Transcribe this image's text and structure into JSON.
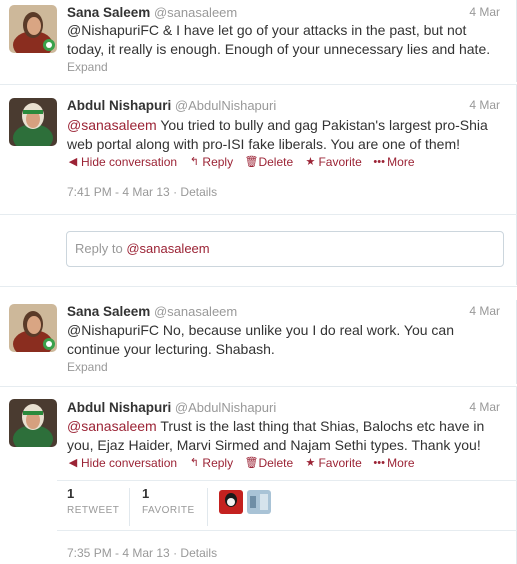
{
  "tweets": [
    {
      "fullname": "Sana Saleem",
      "username": "@sanasaleem",
      "date": "4 Mar",
      "text": "@NishapuriFC & I have let go of your attacks in the past, but not today, it really is enough. Enough of your unnecessary lies and hate.",
      "expand": "Expand"
    },
    {
      "fullname": "Abdul Nishapuri",
      "username": "@AbdulNishapuri",
      "date": "4 Mar",
      "mention": "@sanasaleem",
      "text": " You tried to bully and gag Pakistan's largest pro-Shia web portal along with pro-ISI fake liberals. You are one of them!",
      "actions": {
        "hide": "Hide conversation",
        "reply": "Reply",
        "delete": "Delete",
        "favorite": "Favorite",
        "more": "More"
      },
      "timestamp": "7:41 PM - 4 Mar 13",
      "details": "Details"
    },
    {
      "fullname": "Sana Saleem",
      "username": "@sanasaleem",
      "date": "4 Mar",
      "text": "@NishapuriFC No, because unlike you I do real work. You can continue your lecturing. Shabash.",
      "expand": "Expand"
    },
    {
      "fullname": "Abdul Nishapuri",
      "username": "@AbdulNishapuri",
      "date": "4 Mar",
      "mention": "@sanasaleem",
      "text": " Trust is the last thing that Shias, Balochs etc have in you, Ejaz Haider, Marvi Sirmed and Najam Sethi types. Thank you!",
      "actions": {
        "hide": "Hide conversation",
        "reply": "Reply",
        "delete": "Delete",
        "favorite": "Favorite",
        "more": "More"
      },
      "retweets": {
        "count": "1",
        "label": "RETWEET"
      },
      "favorites": {
        "count": "1",
        "label": "FAVORITE"
      },
      "timestamp": "7:35 PM - 4 Mar 13",
      "details": "Details"
    }
  ],
  "reply_box": {
    "prefix": "Reply to ",
    "mention": "@sanasaleem"
  },
  "colors": {
    "accent": "#9b2335",
    "muted": "#999999"
  }
}
